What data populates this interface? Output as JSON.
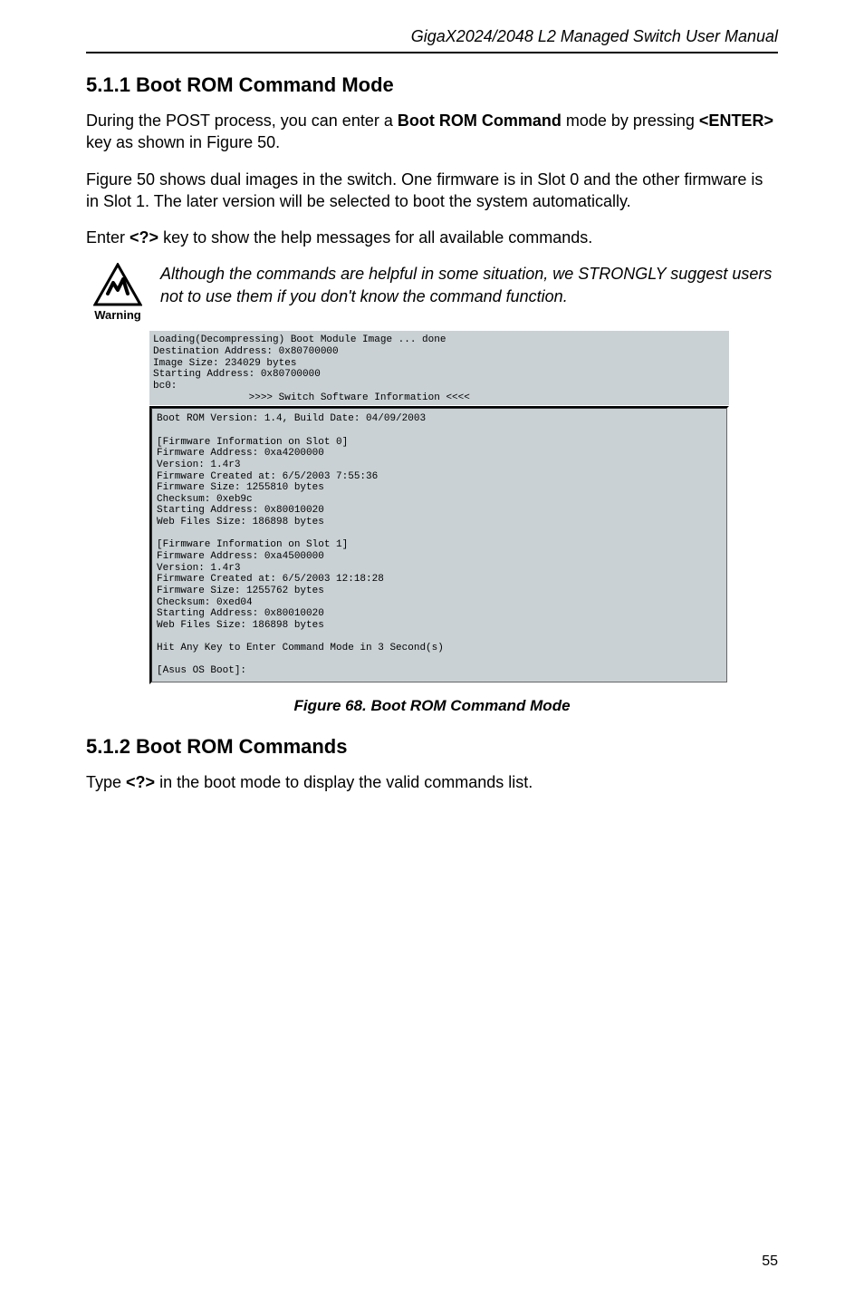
{
  "header": {
    "running_title": "GigaX2024/2048 L2 Managed Switch User Manual"
  },
  "section511": {
    "heading": "5.1.1 Boot ROM Command Mode",
    "para1_pre": "During the POST process, you can enter a ",
    "para1_bold1": "Boot ROM Command",
    "para1_mid": " mode by pressing ",
    "para1_bold2": "<ENTER>",
    "para1_post": " key as shown in Figure 50.",
    "para2": "Figure 50 shows dual images in the switch. One firmware is in Slot 0 and the other firmware is in Slot 1. The later version will be selected to boot the system automatically.",
    "para3_pre": "Enter ",
    "para3_bold": "<?>",
    "para3_post": " key to show the help messages for all available commands."
  },
  "warning": {
    "label": "Warning",
    "text": "Although the commands are helpful in some situation, we STRONGLY suggest users not to use them if you don't know the command function."
  },
  "terminal": {
    "top": "Loading(Decompressing) Boot Module Image ... done\nDestination Address: 0x80700000\nImage Size: 234029 bytes\nStarting Address: 0x80700000\nbc0:\n                >>>> Switch Software Information <<<<",
    "main": "Boot ROM Version: 1.4, Build Date: 04/09/2003\n\n[Firmware Information on Slot 0]\nFirmware Address: 0xa4200000\nVersion: 1.4r3\nFirmware Created at: 6/5/2003 7:55:36\nFirmware Size: 1255810 bytes\nChecksum: 0xeb9c\nStarting Address: 0x80010020\nWeb Files Size: 186898 bytes\n\n[Firmware Information on Slot 1]\nFirmware Address: 0xa4500000\nVersion: 1.4r3\nFirmware Created at: 6/5/2003 12:18:28\nFirmware Size: 1255762 bytes\nChecksum: 0xed04\nStarting Address: 0x80010020\nWeb Files Size: 186898 bytes\n\nHit Any Key to Enter Command Mode in 3 Second(s)\n\n[Asus OS Boot]:"
  },
  "figure_caption": "Figure 68. Boot ROM Command Mode",
  "section512": {
    "heading": "5.1.2 Boot ROM Commands",
    "para_pre": "Type ",
    "para_bold": "<?>",
    "para_post": "  in the boot mode to display the valid commands list."
  },
  "page_number": "55"
}
